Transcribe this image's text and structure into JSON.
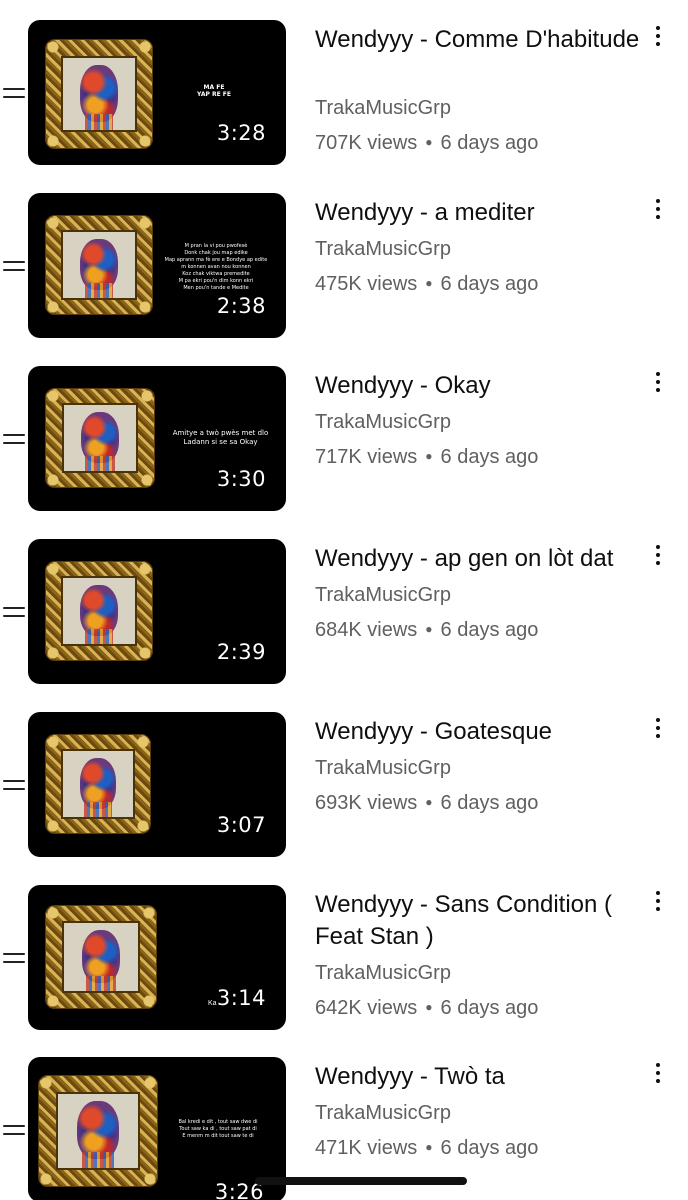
{
  "videos": [
    {
      "title": "Wendyyy - Comme D'habitude",
      "channel": "TrakaMusicGrp",
      "views": "707K views",
      "age": "6 days ago",
      "duration": "3:28",
      "thumb_text": "MA FE\nYAP RE FE",
      "thumb_prefix": ""
    },
    {
      "title": "Wendyyy - a mediter",
      "channel": "TrakaMusicGrp",
      "views": "475K views",
      "age": "6 days ago",
      "duration": "2:38",
      "thumb_text": "M pran la vi pou pwofesè\nDonk chak jou map edike\nMap aprann ma fè ere e Bondye ap edite\nm konnen avan nou konnen\nKoz chak viktwa premedite\nM pa ekri pou'n dim konn ekri\nMen pou'n tande e Medite",
      "thumb_prefix": ""
    },
    {
      "title": "Wendyyy - Okay",
      "channel": "TrakaMusicGrp",
      "views": "717K views",
      "age": "6 days ago",
      "duration": "3:30",
      "thumb_text": "Amitye a twò pwès met dlo\nLadann si se sa Okay",
      "thumb_prefix": ""
    },
    {
      "title": "Wendyyy - ap gen on lòt dat",
      "channel": "TrakaMusicGrp",
      "views": "684K views",
      "age": "6 days ago",
      "duration": "2:39",
      "thumb_text": "",
      "thumb_prefix": ""
    },
    {
      "title": "Wendyyy - Goatesque",
      "channel": "TrakaMusicGrp",
      "views": "693K views",
      "age": "6 days ago",
      "duration": "3:07",
      "thumb_text": "",
      "thumb_prefix": ""
    },
    {
      "title": "Wendyyy - Sans Condition ( Feat Stan )",
      "channel": "TrakaMusicGrp",
      "views": "642K views",
      "age": "6 days ago",
      "duration": "3:14",
      "thumb_text": "",
      "thumb_prefix": "Ka"
    },
    {
      "title": "Wendyyy - Twò ta",
      "channel": "TrakaMusicGrp",
      "views": "471K views",
      "age": "6 days ago",
      "duration": "3:26",
      "thumb_text": "Bal kredi e dit , tout saw dwe di\nTout saw ka di , tout saw pat di\nE menm m dit tout saw te di",
      "thumb_prefix": ""
    }
  ],
  "icons": {
    "drag_handle": "drag-handle-icon",
    "more": "more-vert-icon"
  },
  "colors": {
    "text_primary": "#0f0f0f",
    "text_secondary": "#606060",
    "thumb_bg": "#000000",
    "frame_gold": "#c9a24a"
  }
}
